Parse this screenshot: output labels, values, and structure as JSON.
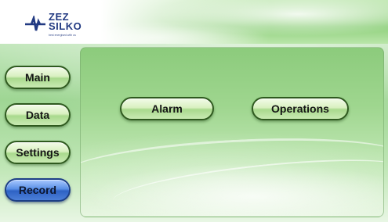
{
  "brand": {
    "logo_line1": "ZEZ",
    "logo_line2": "SILKO",
    "tagline": "best energised with us",
    "logo_icon": "zez-silko-logo-mark",
    "color": "#223a82"
  },
  "nav": {
    "items": [
      {
        "label": "Main",
        "active": false
      },
      {
        "label": "Data",
        "active": false
      },
      {
        "label": "Settings",
        "active": false
      },
      {
        "label": "Record",
        "active": true
      }
    ],
    "active_color": "#2e62c4",
    "button_color": "#c9eab3"
  },
  "main": {
    "buttons": [
      {
        "label": "Alarm"
      },
      {
        "label": "Operations"
      }
    ]
  },
  "theme": {
    "background_green": "#9fd694"
  }
}
